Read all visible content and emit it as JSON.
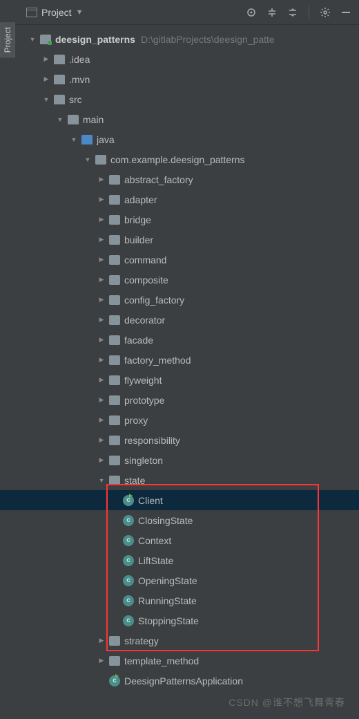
{
  "toolbar": {
    "title": "Project"
  },
  "tree": {
    "root": {
      "name": "deesign_patterns",
      "path": "D:\\gitlabProjects\\deesign_patte"
    },
    "idea": ".idea",
    "mvn": ".mvn",
    "src": "src",
    "main": "main",
    "java": "java",
    "basePkg": "com.example.deesign_patterns",
    "packages": [
      "abstract_factory",
      "adapter",
      "bridge",
      "builder",
      "command",
      "composite",
      "config_factory",
      "decorator",
      "facade",
      "factory_method",
      "flyweight",
      "prototype",
      "proxy",
      "responsibility",
      "singleton"
    ],
    "statePkg": "state",
    "stateClasses": [
      "Client",
      "ClosingState",
      "Context",
      "LiftState",
      "OpeningState",
      "RunningState",
      "StoppingState"
    ],
    "afterPackages": [
      "strategy",
      "template_method"
    ],
    "appClass": "DeesignPatternsApplication"
  },
  "watermark": "CSDN @谁不想飞舞青春"
}
